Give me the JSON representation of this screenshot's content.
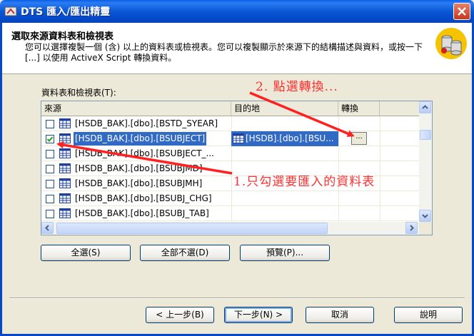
{
  "window": {
    "title": "DTS 匯入/匯出精靈",
    "icons": [
      "app-icon",
      "close-icon"
    ]
  },
  "header": {
    "title": "選取來源資料表和檢視表",
    "description": "您可以選擇複製一個 (含) 以上的資料表或檢視表。您可以複製顯示於來源下的結構描述與資料，或按一下 [...] 以使用 ActiveX Script 轉換資料。",
    "icon": "database-icon"
  },
  "list": {
    "label": "資料表和檢視表(T):",
    "columns": [
      "來源",
      "目的地",
      "轉換"
    ],
    "rows": [
      {
        "checked": false,
        "source": "[HSDB_BAK].[dbo].[BSTD_SYEAR]",
        "destination": "",
        "selected": false
      },
      {
        "checked": true,
        "source": "[HSDB_BAK].[dbo].[BSUBJECT]",
        "destination": "[HSDB].[dbo].[BSU...",
        "selected": true,
        "browse": "..."
      },
      {
        "checked": false,
        "source": "[HSDB_BAK].[dbo].[BSUBJECT_...",
        "destination": "",
        "selected": false
      },
      {
        "checked": false,
        "source": "[HSDB_BAK].[dbo].[BSUBJMD]",
        "destination": "",
        "selected": false
      },
      {
        "checked": false,
        "source": "[HSDB_BAK].[dbo].[BSUBJMH]",
        "destination": "",
        "selected": false
      },
      {
        "checked": false,
        "source": "[HSDB_BAK].[dbo].[BSUBJ_CHG]",
        "destination": "",
        "selected": false
      },
      {
        "checked": false,
        "source": "[HSDB_BAK].[dbo].[BSUBJ_TAB]",
        "destination": "",
        "selected": false
      }
    ]
  },
  "buttons": {
    "select_all": "全選(S)",
    "deselect_all": "全部不選(D)",
    "preview": "預覽(P)...",
    "back": "< 上一步(B)",
    "next": "下一步(N) >",
    "cancel": "取消",
    "help": "說明"
  },
  "annotations": {
    "step2": "2. 點選轉換...",
    "step1": "1.只勾選要匯入的資料表",
    "color": "#ff3030"
  },
  "colors": {
    "title_bar": "#0a57d6",
    "selection": "#316ac5"
  }
}
